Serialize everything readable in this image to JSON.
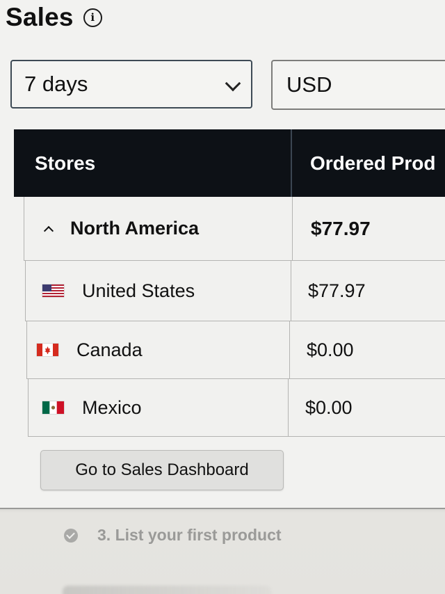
{
  "widget": {
    "title": "Sales",
    "info_icon": "info-icon"
  },
  "filters": {
    "range_value": "7 days",
    "range_icon": "chevron-down-icon",
    "currency_value": "USD"
  },
  "table": {
    "headers": [
      "Stores",
      "Ordered Prod"
    ],
    "rows": [
      {
        "store": "North America",
        "value": "$77.97",
        "icon": "caret-up-icon"
      },
      {
        "store": "United States",
        "value": "$77.97",
        "icon": "us-flag-icon"
      },
      {
        "store": "Canada",
        "value": "$0.00",
        "icon": "canada-flag-icon"
      },
      {
        "store": "Mexico",
        "value": "$0.00",
        "icon": "mexico-flag-icon"
      }
    ]
  },
  "actions": {
    "dashboard_label": "Go to Sales Dashboard"
  },
  "checklist": {
    "step_label": "3. List your first product",
    "step_icon": "check-circle-icon"
  },
  "colors": {
    "header_bg": "#0d1116",
    "header_text": "#ffffff",
    "muted_text": "#9a9a98"
  }
}
